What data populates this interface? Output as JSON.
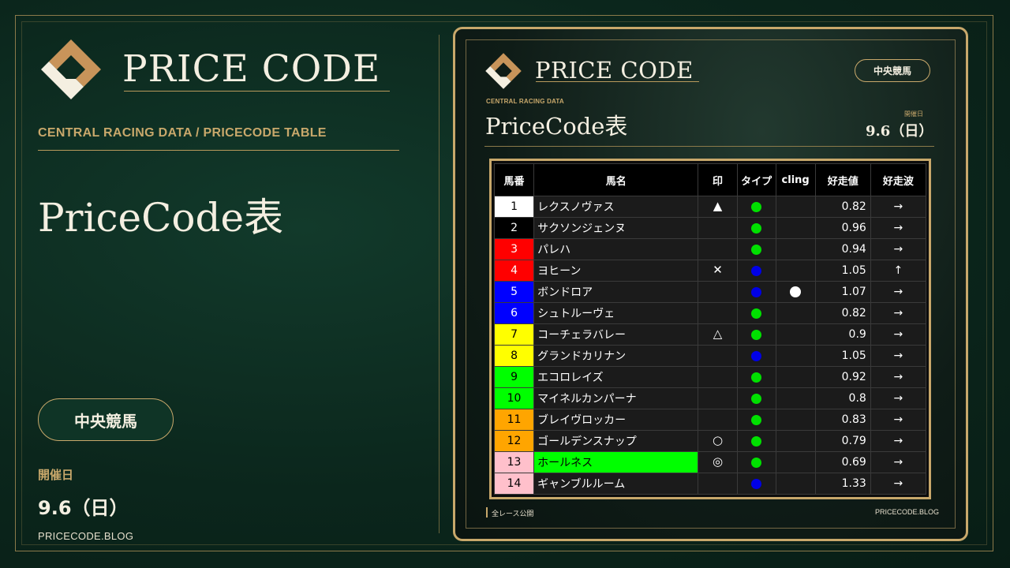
{
  "brand": {
    "name": "PRICE CODE"
  },
  "left": {
    "subtitle": "CENTRAL RACING DATA  /  PRICECODE TABLE",
    "title": "PriceCode表",
    "category": "中央競馬",
    "date_label": "開催日",
    "date": "9.6（日）",
    "site": "PRICECODE.BLOG"
  },
  "card": {
    "brand": "PRICE CODE",
    "category": "中央競馬",
    "subtitle": "CENTRAL RACING DATA",
    "title": "PriceCode表",
    "date_label": "開催日",
    "date": "9.6（日）",
    "footer_left": "全レース公開",
    "footer_right": "PRICECODE.BLOG"
  },
  "colors": {
    "gold": "#c8a86b",
    "bg": "#0d2a1f",
    "dot_green": "#00e000",
    "dot_blue": "#0000e6",
    "highlight_green": "#00ff00"
  },
  "table": {
    "headers": [
      "馬番",
      "馬名",
      "印",
      "タイプ",
      "cling",
      "好走値",
      "好走波"
    ],
    "rows": [
      {
        "num": "1",
        "name": "レクスノヴァス",
        "mark": "▲",
        "type": "green",
        "cling": "",
        "value": "0.82",
        "wave": "→",
        "num_bg": "#ffffff",
        "num_fg": "#000000",
        "name_bg": ""
      },
      {
        "num": "2",
        "name": "サクソンジェンヌ",
        "mark": "",
        "type": "green",
        "cling": "",
        "value": "0.96",
        "wave": "→",
        "num_bg": "#000000",
        "num_fg": "#ffffff",
        "name_bg": ""
      },
      {
        "num": "3",
        "name": "パレハ",
        "mark": "",
        "type": "green",
        "cling": "",
        "value": "0.94",
        "wave": "→",
        "num_bg": "#ff0000",
        "num_fg": "#ffffff",
        "name_bg": ""
      },
      {
        "num": "4",
        "name": "ヨヒーン",
        "mark": "✕",
        "type": "blue",
        "cling": "",
        "value": "1.05",
        "wave": "↑",
        "num_bg": "#ff0000",
        "num_fg": "#ffffff",
        "name_bg": ""
      },
      {
        "num": "5",
        "name": "ボンドロア",
        "mark": "",
        "type": "blue",
        "cling": "●",
        "value": "1.07",
        "wave": "→",
        "num_bg": "#0000ff",
        "num_fg": "#ffffff",
        "name_bg": ""
      },
      {
        "num": "6",
        "name": "シュトルーヴェ",
        "mark": "",
        "type": "green",
        "cling": "",
        "value": "0.82",
        "wave": "→",
        "num_bg": "#0000ff",
        "num_fg": "#ffffff",
        "name_bg": ""
      },
      {
        "num": "7",
        "name": "コーチェラバレー",
        "mark": "△",
        "type": "green",
        "cling": "",
        "value": "0.9",
        "wave": "→",
        "num_bg": "#ffff00",
        "num_fg": "#000000",
        "name_bg": ""
      },
      {
        "num": "8",
        "name": "グランドカリナン",
        "mark": "",
        "type": "blue",
        "cling": "",
        "value": "1.05",
        "wave": "→",
        "num_bg": "#ffff00",
        "num_fg": "#000000",
        "name_bg": ""
      },
      {
        "num": "9",
        "name": "エコロレイズ",
        "mark": "",
        "type": "green",
        "cling": "",
        "value": "0.92",
        "wave": "→",
        "num_bg": "#00ff00",
        "num_fg": "#000000",
        "name_bg": ""
      },
      {
        "num": "10",
        "name": "マイネルカンパーナ",
        "mark": "",
        "type": "green",
        "cling": "",
        "value": "0.8",
        "wave": "→",
        "num_bg": "#00ff00",
        "num_fg": "#000000",
        "name_bg": ""
      },
      {
        "num": "11",
        "name": "ブレイヴロッカー",
        "mark": "",
        "type": "green",
        "cling": "",
        "value": "0.83",
        "wave": "→",
        "num_bg": "#ffa500",
        "num_fg": "#000000",
        "name_bg": ""
      },
      {
        "num": "12",
        "name": "ゴールデンスナップ",
        "mark": "○",
        "type": "green",
        "cling": "",
        "value": "0.79",
        "wave": "→",
        "num_bg": "#ffa500",
        "num_fg": "#000000",
        "name_bg": ""
      },
      {
        "num": "13",
        "name": "ホールネス",
        "mark": "◎",
        "type": "green",
        "cling": "",
        "value": "0.69",
        "wave": "→",
        "num_bg": "#ffc0cb",
        "num_fg": "#000000",
        "name_bg": "#00ff00"
      },
      {
        "num": "14",
        "name": "ギャンブルルーム",
        "mark": "",
        "type": "blue",
        "cling": "",
        "value": "1.33",
        "wave": "→",
        "num_bg": "#ffc0cb",
        "num_fg": "#000000",
        "name_bg": ""
      }
    ]
  }
}
